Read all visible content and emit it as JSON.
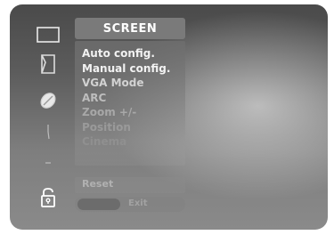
{
  "title": "SCREEN",
  "menu_items": [
    {
      "label": "Auto config.",
      "color": "#f2f2f2"
    },
    {
      "label": "Manual config.",
      "color": "#f2f2f2"
    },
    {
      "label": "VGA Mode",
      "color": "#d2d2d2"
    },
    {
      "label": "ARC",
      "color": "#bdbdbd"
    },
    {
      "label": "Zoom +/-",
      "color": "#a8a8a8"
    },
    {
      "label": "Position",
      "color": "#9a9a9a"
    },
    {
      "label": "Cinema",
      "color": "#909090"
    }
  ],
  "reset_label": "Reset",
  "footer_label": "Exit",
  "sidebar_icons": [
    "screen-icon",
    "picture-icon",
    "sound-icon",
    "time-icon",
    "option-icon",
    "lock-icon"
  ]
}
